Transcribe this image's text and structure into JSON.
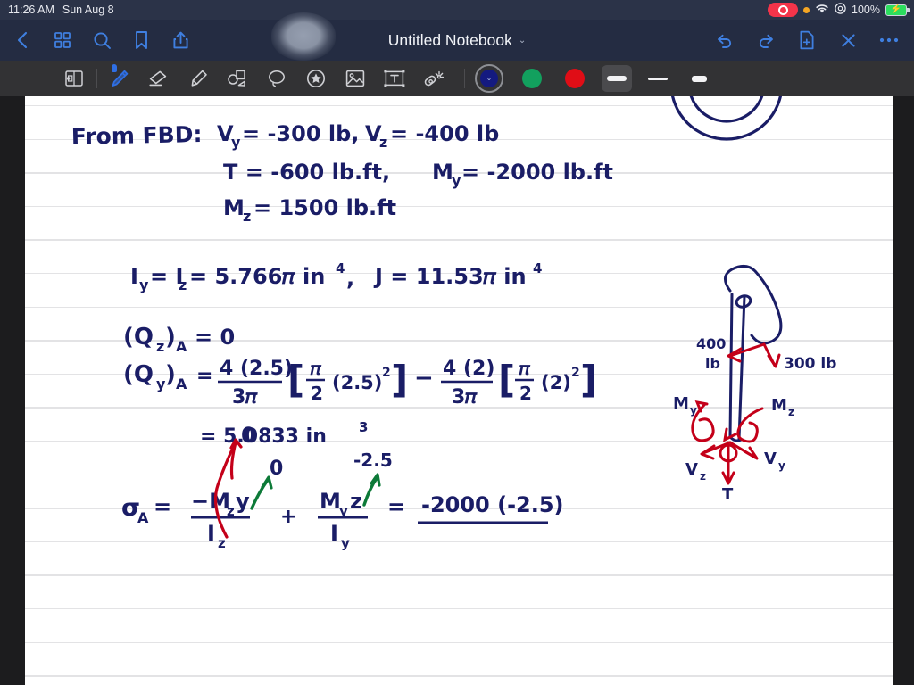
{
  "status_bar": {
    "time": "11:26 AM",
    "date": "Sun Aug 8",
    "battery_percent": "100%",
    "icons": [
      "record-indicator",
      "orange-dot",
      "wifi-icon",
      "location-icon",
      "battery-charging-icon"
    ],
    "colors": {
      "background": "#2b3348",
      "text": "#e8eaf0",
      "record": "#f4344a",
      "battery": "#2cdd5e"
    }
  },
  "header": {
    "title": "Untitled Notebook",
    "title_chevron": "⌄",
    "left_icons": [
      {
        "name": "back-chevron-icon",
        "label": "Back"
      },
      {
        "name": "grid-thumbnails-icon",
        "label": "Page Thumbnails"
      },
      {
        "name": "search-icon",
        "label": "Search"
      },
      {
        "name": "bookmark-icon",
        "label": "Bookmark"
      },
      {
        "name": "share-icon",
        "label": "Share"
      }
    ],
    "right_icons": [
      {
        "name": "undo-icon",
        "label": "Undo"
      },
      {
        "name": "redo-icon",
        "label": "Redo"
      },
      {
        "name": "add-page-icon",
        "label": "New Page"
      },
      {
        "name": "close-icon",
        "label": "Close"
      },
      {
        "name": "more-options-icon",
        "label": "More"
      }
    ],
    "colors": {
      "background": "#242c42",
      "icon": "#3f7fe0",
      "title": "#f2f4f8"
    }
  },
  "toolbar": {
    "background": "#323234",
    "tools": [
      {
        "name": "page-layout-icon",
        "label": "Page Layout",
        "selected": false
      },
      {
        "name": "pen-icon",
        "label": "Pen",
        "selected": true
      },
      {
        "name": "eraser-icon",
        "label": "Eraser",
        "selected": false
      },
      {
        "name": "highlighter-icon",
        "label": "Highlighter",
        "selected": false
      },
      {
        "name": "shapes-icon",
        "label": "Shapes",
        "selected": false
      },
      {
        "name": "lasso-select-icon",
        "label": "Lasso Select",
        "selected": false
      },
      {
        "name": "sticker-icon",
        "label": "Stickers",
        "selected": false
      },
      {
        "name": "image-icon",
        "label": "Insert Image",
        "selected": false
      },
      {
        "name": "text-box-icon",
        "label": "Text Box",
        "selected": false
      },
      {
        "name": "laser-pointer-icon",
        "label": "Laser Pointer",
        "selected": false
      }
    ],
    "colors": [
      {
        "name": "color-swatch-navy",
        "hex": "#141a80",
        "selected": true
      },
      {
        "name": "color-swatch-green",
        "hex": "#12a05e",
        "selected": false
      },
      {
        "name": "color-swatch-red",
        "hex": "#e00d16",
        "selected": false
      }
    ],
    "stroke_widths": [
      {
        "name": "stroke-width-thick",
        "thickness": 6,
        "length": 22,
        "selected": true
      },
      {
        "name": "stroke-width-medium",
        "thickness": 3,
        "length": 22,
        "selected": false
      },
      {
        "name": "stroke-width-thin",
        "thickness": 7,
        "length": 17,
        "selected": false
      }
    ]
  },
  "notes": {
    "ink_colors": {
      "navy": "#1a1d66",
      "red": "#c40019",
      "green": "#0d7a38"
    },
    "lines": [
      {
        "id": "line-fbd-header",
        "text": "From FBD:   V_y = -300 lb,  V_z = -400 lb"
      },
      {
        "id": "line-torque",
        "text": "T = -600 lb.ft,   M_y = -2000 lb.ft"
      },
      {
        "id": "line-mz",
        "text": "M_z = 1500 lb.ft"
      },
      {
        "id": "line-inertia",
        "text": "I_y = I_z = 5.766π in^4,   J = 11.53π in^4"
      },
      {
        "id": "line-qz",
        "text": "(Q_z)_A = 0"
      },
      {
        "id": "line-qy",
        "text": "(Q_y)_A = 4(2.5)/3π [ π/2 (2.5)^2 ] − 4(2)/3π [ π/2 (2)^2 ]"
      },
      {
        "id": "line-qy-result",
        "text": "= 5.0833 in^3"
      },
      {
        "id": "line-sigma",
        "text": "σ_A = -M_z y / I_z  +  M_y z / I_y  =  -2000 (-2.5)"
      }
    ],
    "annotations": [
      {
        "id": "annot-strike-mz",
        "color": "#c40019",
        "note": "red strikethrough over -M_z y / I_z term"
      },
      {
        "id": "annot-zero-red",
        "color": "#c40019",
        "text": "0"
      },
      {
        "id": "annot-zero-green",
        "color": "#0d7a38",
        "text": "0"
      },
      {
        "id": "annot-neg-2-5",
        "color": "#0d7a38",
        "text": "-2.5"
      },
      {
        "id": "annot-underline-result",
        "color": "#1a1d66",
        "note": "underline beneath -2000 (-2.5)"
      }
    ],
    "diagram": {
      "id": "free-body-diagram",
      "labels": [
        {
          "text": "400 lb",
          "color": "#c40019"
        },
        {
          "text": "300 lb",
          "color": "#c40019"
        },
        {
          "text": "M_y",
          "color": "#c40019"
        },
        {
          "text": "M_z",
          "color": "#c40019"
        },
        {
          "text": "V_z",
          "color": "#c40019"
        },
        {
          "text": "V_y",
          "color": "#c40019"
        },
        {
          "text": "T",
          "color": "#c40019"
        }
      ],
      "shapes": [
        "concentric-arcs",
        "bent-bar-outline",
        "force-arrows",
        "moment-arrows"
      ]
    }
  }
}
